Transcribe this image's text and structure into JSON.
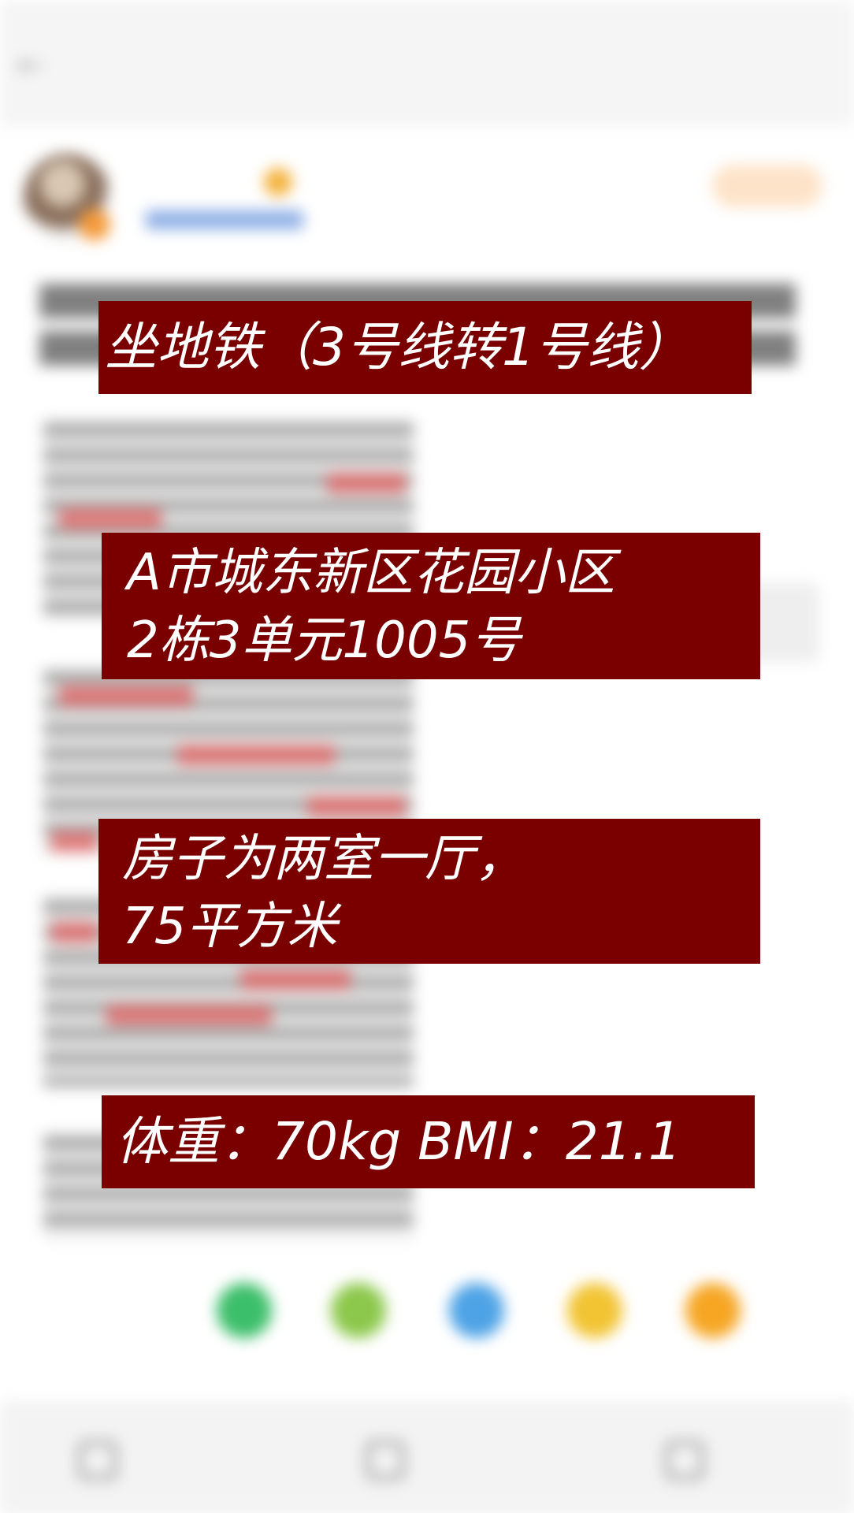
{
  "nav": {
    "back_icon": "back-arrow-icon",
    "title": "",
    "more": ""
  },
  "post": {
    "author_name": "",
    "author_meta": "",
    "follow_label": ""
  },
  "share": {
    "label": "",
    "icons": [
      {
        "name": "wechat-icon",
        "color": "#3cbf6a"
      },
      {
        "name": "moments-icon",
        "color": "#8cc84b"
      },
      {
        "name": "qq-icon",
        "color": "#4ea3e6"
      },
      {
        "name": "qzone-icon",
        "color": "#f2c433"
      },
      {
        "name": "weibo-icon",
        "color": "#f6a623"
      }
    ]
  },
  "bottom_bar": {
    "tabs": [
      "",
      "",
      ""
    ]
  },
  "overlays": {
    "transport": "坐地铁（3号线转1号线）",
    "address": "A市城东新区花园小区\n2栋3单元1005号",
    "house": "房子为两室一厅，\n75平方米",
    "body": "体重：70kg  BMI：21.1"
  },
  "colors": {
    "overlay_bg": "#7a0000",
    "overlay_text": "#ffffff",
    "accent": "#f08a34"
  }
}
